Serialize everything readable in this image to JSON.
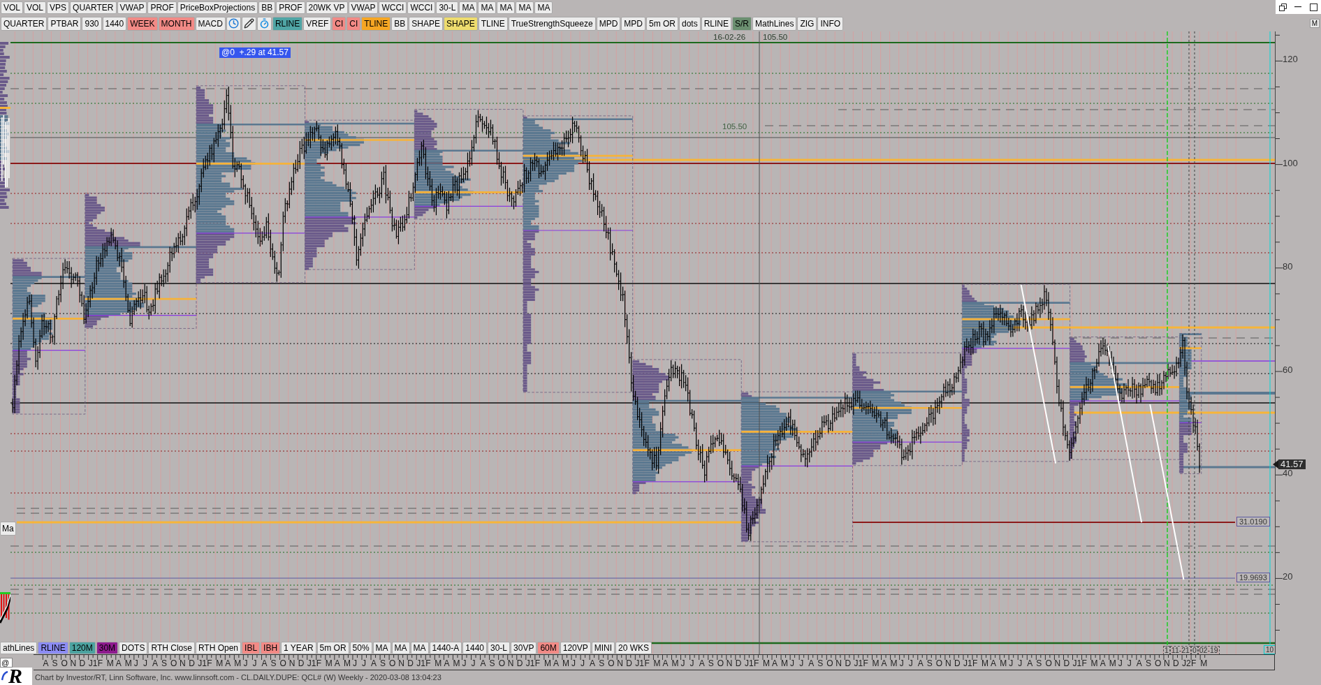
{
  "toolbar_top": [
    {
      "label": "VOL"
    },
    {
      "label": "VOL"
    },
    {
      "label": "VPS"
    },
    {
      "label": "QUARTER"
    },
    {
      "label": "VWAP"
    },
    {
      "label": "PROF"
    },
    {
      "label": "PriceBoxProjections"
    },
    {
      "label": "BB"
    },
    {
      "label": "PROF"
    },
    {
      "label": "20WK VP"
    },
    {
      "label": "VWAP"
    },
    {
      "label": "WCCI"
    },
    {
      "label": "WCCI"
    },
    {
      "label": "30-L"
    },
    {
      "label": "MA"
    },
    {
      "label": "MA"
    },
    {
      "label": "MA"
    },
    {
      "label": "MA"
    },
    {
      "label": "MA"
    }
  ],
  "toolbar_studies": {
    "left": [
      {
        "label": "QUARTER"
      },
      {
        "label": "PTBAR"
      },
      {
        "label": "930"
      },
      {
        "label": "1440"
      },
      {
        "label": "WEEK",
        "color": "#f28a86"
      },
      {
        "label": "MONTH",
        "color": "#f28a86"
      },
      {
        "label": "MACD"
      }
    ],
    "right": [
      {
        "label": "RLINE",
        "color": "#4fa5a5"
      },
      {
        "label": "VREF"
      },
      {
        "label": "CI",
        "color": "#f28a86"
      },
      {
        "label": "CI",
        "color": "#f28a86"
      },
      {
        "label": "TLINE",
        "color": "#f6a623"
      },
      {
        "label": "BB"
      },
      {
        "label": "SHAPE"
      },
      {
        "label": "SHAPE",
        "color": "#eedc6e"
      },
      {
        "label": "TLINE"
      },
      {
        "label": "TrueStrengthSqueeze"
      },
      {
        "label": "MPD"
      },
      {
        "label": "MPD"
      },
      {
        "label": "5m OR"
      },
      {
        "label": "dots"
      },
      {
        "label": "RLINE"
      },
      {
        "label": "S/R",
        "color": "#6b8f70"
      },
      {
        "label": "MathLines"
      },
      {
        "label": "ZIG"
      },
      {
        "label": "INFO"
      }
    ]
  },
  "corner_button": "M",
  "chart": {
    "crosshair_date": "16-02-26",
    "crosshair_price": "105.50",
    "info_badge": "@0  +.29 at 41.57",
    "level_label": "105.50",
    "side_tab": "Ma",
    "price_labels": [
      "31.0190",
      "19.9693"
    ],
    "date_labels": [
      "1",
      "11-21",
      "0",
      "02-19"
    ],
    "scale_box": "10"
  },
  "price_axis": {
    "labels": [
      "120",
      "100",
      "80",
      "60",
      "40",
      "20"
    ],
    "last_price": "41.57"
  },
  "toolbar_bottom": [
    {
      "label": "athLines"
    },
    {
      "label": "RLINE",
      "color": "#8c8cf4"
    },
    {
      "label": "120M",
      "color": "#4ca3a0"
    },
    {
      "label": "30M",
      "color": "#8e1a8e"
    },
    {
      "label": "DOTS"
    },
    {
      "label": "RTH Close"
    },
    {
      "label": "RTH Open"
    },
    {
      "label": "IBL",
      "color": "#f28a86"
    },
    {
      "label": "IBH",
      "color": "#f28a86"
    },
    {
      "label": "1 YEAR"
    },
    {
      "label": "5m OR"
    },
    {
      "label": "50%"
    },
    {
      "label": "MA"
    },
    {
      "label": "MA"
    },
    {
      "label": "MA"
    },
    {
      "label": "1440-A"
    },
    {
      "label": "1440"
    },
    {
      "label": "30-L"
    },
    {
      "label": "30VP"
    },
    {
      "label": "60M",
      "color": "#f28a86"
    },
    {
      "label": "120VP"
    },
    {
      "label": "MINI"
    },
    {
      "label": "20 WKS"
    }
  ],
  "time_axis": {
    "labels": [
      "A",
      "S",
      "O",
      "N",
      "D",
      "J1",
      "F",
      "M",
      "A",
      "M",
      "J",
      "J",
      "A",
      "S",
      "O",
      "N",
      "D",
      "J1",
      "F",
      "M",
      "A",
      "M",
      "J",
      "J",
      "A",
      "S",
      "O",
      "N",
      "D",
      "J1",
      "F",
      "M",
      "A",
      "M",
      "J",
      "J",
      "A",
      "S",
      "O",
      "N",
      "D",
      "J1",
      "F",
      "M",
      "A",
      "M",
      "J",
      "J",
      "A",
      "S",
      "O",
      "N",
      "D",
      "J1",
      "F",
      "M",
      "A",
      "M",
      "J",
      "J",
      "A",
      "S",
      "O",
      "N",
      "D",
      "J1",
      "F",
      "M",
      "A",
      "M",
      "J",
      "J",
      "A",
      "S",
      "O",
      "N",
      "D",
      "J1",
      "F",
      "M",
      "A",
      "M",
      "J",
      "J",
      "A",
      "S",
      "O",
      "N",
      "D",
      "J1",
      "F",
      "M",
      "A",
      "M",
      "J",
      "J",
      "A",
      "S",
      "O",
      "N",
      "D",
      "J1",
      "F",
      "M",
      "A",
      "M",
      "J",
      "J",
      "A",
      "S",
      "O",
      "N",
      "D",
      "J1",
      "F",
      "M",
      "A",
      "M",
      "J",
      "J",
      "A",
      "S",
      "O",
      "N",
      "D",
      "J2",
      "F",
      "M"
    ]
  },
  "symbol_field": {
    "value": "@"
  },
  "logo": "R",
  "footer": "Chart by Investor/RT, Linn Software, Inc. www.linnsoft.com - CL.DAILY.DUPE: QCL# (W) Weekly - 2020-03-08 13:04:23"
}
